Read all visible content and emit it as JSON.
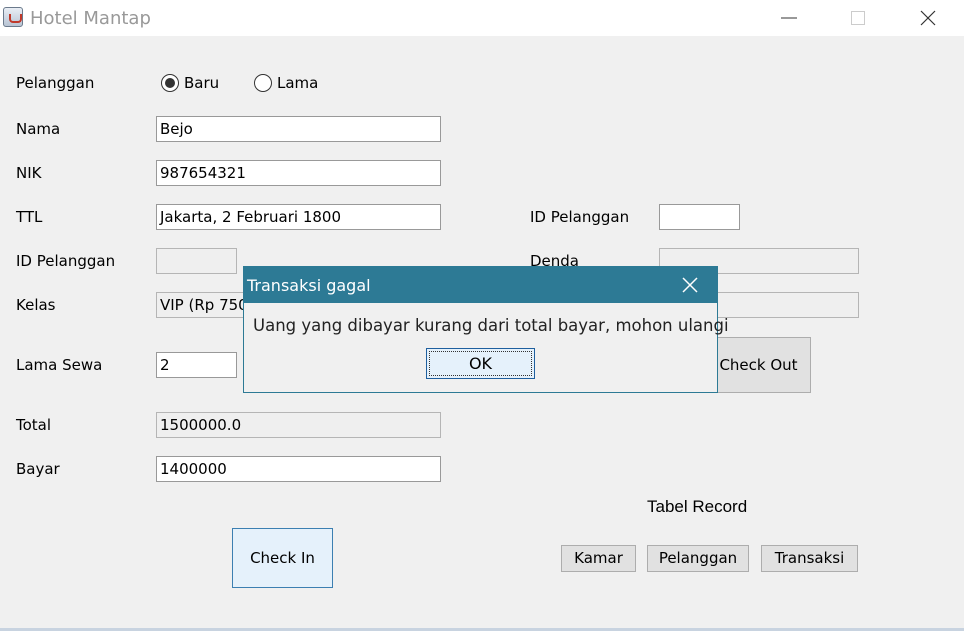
{
  "window": {
    "title": "Hotel Mantap"
  },
  "form": {
    "pelanggan_label": "Pelanggan",
    "radio_baru": "Baru",
    "radio_lama": "Lama",
    "nama_label": "Nama",
    "nama_value": "Bejo",
    "nik_label": "NIK",
    "nik_value": "987654321",
    "ttl_label": "TTL",
    "ttl_value": "Jakarta, 2 Februari 1800",
    "id_pelanggan_label": "ID Pelanggan",
    "id_pelanggan_value": "",
    "kelas_label": "Kelas",
    "kelas_value": "VIP (Rp 750",
    "lama_sewa_label": "Lama Sewa",
    "lama_sewa_value": "2",
    "total_label": "Total",
    "total_value": "1500000.0",
    "bayar_label": "Bayar",
    "bayar_value": "1400000",
    "checkin_label": "Check In"
  },
  "checkout": {
    "id_pelanggan_label": "ID Pelanggan",
    "id_pelanggan_value": "",
    "denda_label": "Denda",
    "denda_value": "",
    "field3_value": "",
    "checkout_label": "Check Out"
  },
  "records": {
    "title": "Tabel Record",
    "kamar_label": "Kamar",
    "pelanggan_label": "Pelanggan",
    "transaksi_label": "Transaksi"
  },
  "dialog": {
    "title": "Transaksi gagal",
    "message": "Uang yang dibayar kurang dari total bayar, mohon ulangi",
    "ok_label": "OK"
  },
  "colors": {
    "dialog_title_bg": "#2d7a95",
    "focus_border": "#3c7fb1"
  }
}
